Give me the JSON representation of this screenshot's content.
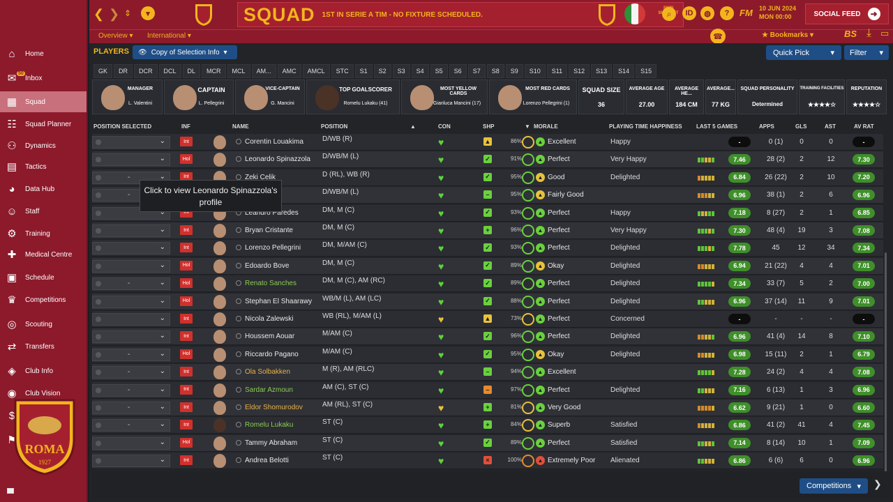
{
  "header": {
    "title": "SQUAD",
    "subtitle": "1ST IN SERIE A TIM - NO FIXTURE SCHEDULED.",
    "skin_support": "SKIN SUPPORT",
    "id_label": "ID",
    "help_label": "?",
    "fm_label": "FM",
    "date": "10 JUN 2024",
    "time": "MON 00:00",
    "social_feed": "SOCIAL FEED"
  },
  "subheader": {
    "overview": "Overview",
    "international": "International",
    "bookmarks": "Bookmarks",
    "bs": "BS"
  },
  "sidebar": {
    "inbox_badge": "50",
    "items": [
      {
        "label": "Home",
        "icon": "home-icon",
        "glyph": "⌂"
      },
      {
        "label": "Inbox",
        "icon": "inbox-icon",
        "glyph": "✉"
      },
      {
        "label": "Squad",
        "icon": "squad-icon",
        "glyph": "▦"
      },
      {
        "label": "Squad Planner",
        "icon": "squad-planner-icon",
        "glyph": "☷"
      },
      {
        "label": "Dynamics",
        "icon": "dynamics-icon",
        "glyph": "⚇"
      },
      {
        "label": "Tactics",
        "icon": "tactics-icon",
        "glyph": "▤"
      },
      {
        "label": "Data Hub",
        "icon": "data-hub-icon",
        "glyph": "◕"
      },
      {
        "label": "Staff",
        "icon": "staff-icon",
        "glyph": "☺"
      },
      {
        "label": "Training",
        "icon": "training-icon",
        "glyph": "⚙"
      },
      {
        "label": "Medical Centre",
        "icon": "medical-centre-icon",
        "glyph": "✚"
      },
      {
        "label": "Schedule",
        "icon": "schedule-icon",
        "glyph": "▣"
      },
      {
        "label": "Competitions",
        "icon": "competitions-icon",
        "glyph": "♛"
      },
      {
        "label": "Scouting",
        "icon": "scouting-icon",
        "glyph": "◎"
      },
      {
        "label": "Transfers",
        "icon": "transfers-icon",
        "glyph": "⇄"
      },
      {
        "label": "Club Info",
        "icon": "club-info-icon",
        "glyph": "◈"
      },
      {
        "label": "Club Vision",
        "icon": "club-vision-icon",
        "glyph": "◉"
      },
      {
        "label": "Finances",
        "icon": "finances-icon",
        "glyph": "$"
      },
      {
        "label": "Dev. Centre",
        "icon": "dev-centre-icon",
        "glyph": "⚑"
      }
    ],
    "crest_year": "1927",
    "crest_text": "ROMA"
  },
  "toolbar": {
    "players_label": "PLAYERS",
    "copy_selection": "Copy of Selection Info",
    "quick_pick": "Quick Pick",
    "filter": "Filter"
  },
  "position_tabs": [
    "GK",
    "DR",
    "DCR",
    "DCL",
    "DL",
    "MCR",
    "MCL",
    "AM...",
    "AMC",
    "AMCL",
    "STC",
    "S1",
    "S2",
    "S3",
    "S4",
    "S5",
    "S6",
    "S7",
    "S8",
    "S9",
    "S10",
    "S11",
    "S12",
    "S13",
    "S14",
    "S15"
  ],
  "cards": {
    "manager": {
      "title": "MANAGER",
      "value": "L. Valentini"
    },
    "captain": {
      "title": "CAPTAIN",
      "value": "L. Pellegrini"
    },
    "vice_captain": {
      "title": "VICE-CAPTAIN",
      "value": "G. Mancini"
    },
    "top_goalscorer": {
      "title": "TOP GOALSCORER",
      "value": "Romelu Lukaku (41)"
    },
    "most_yellow": {
      "title": "MOST YELLOW CARDS",
      "value": "Gianluca Mancini (17)"
    },
    "most_red": {
      "title": "MOST RED CARDS",
      "value": "Lorenzo Pellegrini (1)"
    },
    "squad_size": {
      "title": "SQUAD SIZE",
      "value": "36"
    },
    "average_age": {
      "title": "AVERAGE AGE",
      "value": "27.00"
    },
    "average_height": {
      "title": "AVERAGE HE...",
      "value": "184 CM"
    },
    "average_weight": {
      "title": "AVERAGE...",
      "value": "77 KG"
    },
    "squad_personality": {
      "title": "SQUAD PERSONALITY",
      "value": "Determined"
    },
    "training_facilities": {
      "title": "TRAINING FACILITIES",
      "stars": 4.5
    },
    "reputation": {
      "title": "REPUTATION",
      "stars": 4.5
    }
  },
  "columns": {
    "position_selected": "POSITION SELECTED",
    "inf": "INF",
    "name": "NAME",
    "position": "POSITION",
    "con": "CON",
    "shp": "SHP",
    "morale": "MORALE",
    "playing_time": "PLAYING TIME HAPPINESS",
    "last5": "LAST 5 GAMES",
    "apps": "APPS",
    "gls": "GLS",
    "ast": "AST",
    "avrat": "AV RAT"
  },
  "players": [
    {
      "sel": "",
      "inf": "Int",
      "name": "Corentin Louakima",
      "color": "",
      "pos": "D/WB (R)",
      "con": "♥",
      "conc": "",
      "shp": "▲",
      "shpc": "up",
      "cond": "86%",
      "ring": "y",
      "mic": "",
      "morale": "Excellent",
      "pt": "Happy",
      "form": "",
      "frat": "-",
      "frc": "black",
      "apps": "0 (1)",
      "gls": "0",
      "ast": "0",
      "avr": "-",
      "avc": "black",
      "dark": false
    },
    {
      "sel": "",
      "inf": "Hol",
      "name": "Leonardo Spinazzola",
      "color": "",
      "pos": "D/WB/M (L)",
      "con": "♥",
      "conc": "",
      "shp": "✓",
      "shpc": "",
      "cond": "91%",
      "ring": "",
      "mic": "",
      "morale": "Perfect",
      "pt": "Very Happy",
      "form": "ggyyg",
      "frat": "7.46",
      "frc": "",
      "apps": "28 (2)",
      "gls": "2",
      "ast": "12",
      "avr": "7.30",
      "avc": "",
      "dark": false
    },
    {
      "sel": "-",
      "inf": "Int",
      "name": "Zeki Celik",
      "color": "",
      "pos": "D (RL), WB (R)",
      "con": "♥",
      "conc": "",
      "shp": "✓",
      "shpc": "",
      "cond": "95%",
      "ring": "",
      "mic": "y",
      "morale": "Good",
      "pt": "Delighted",
      "form": "oyyyy",
      "frat": "6.84",
      "frc": "",
      "apps": "26 (22)",
      "gls": "2",
      "ast": "10",
      "avr": "7.20",
      "avc": "",
      "dark": false
    },
    {
      "sel": "-",
      "inf": "Int",
      "name": "",
      "color": "",
      "pos": "D/WB/M (L)",
      "con": "♥",
      "conc": "",
      "shp": "–",
      "shpc": "",
      "cond": "95%",
      "ring": "",
      "mic": "y",
      "morale": "Fairly Good",
      "pt": "",
      "form": "oooyy",
      "frat": "6.96",
      "frc": "",
      "apps": "38 (1)",
      "gls": "2",
      "ast": "6",
      "avr": "6.96",
      "avc": "",
      "dark": false
    },
    {
      "sel": "",
      "inf": "Int",
      "name": "Leandro Paredes",
      "color": "",
      "pos": "DM, M (C)",
      "con": "♥",
      "conc": "",
      "shp": "✓",
      "shpc": "",
      "cond": "93%",
      "ring": "",
      "mic": "",
      "morale": "Perfect",
      "pt": "Happy",
      "form": "gyygg",
      "frat": "7.18",
      "frc": "",
      "apps": "8 (27)",
      "gls": "2",
      "ast": "1",
      "avr": "6.85",
      "avc": "",
      "dark": false
    },
    {
      "sel": "",
      "inf": "Int",
      "name": "Bryan Cristante",
      "color": "",
      "pos": "DM, M (C)",
      "con": "♥",
      "conc": "",
      "shp": "+",
      "shpc": "",
      "cond": "96%",
      "ring": "",
      "mic": "",
      "morale": "Perfect",
      "pt": "Very Happy",
      "form": "gggyg",
      "frat": "7.30",
      "frc": "",
      "apps": "48 (4)",
      "gls": "19",
      "ast": "3",
      "avr": "7.08",
      "avc": "",
      "dark": false
    },
    {
      "sel": "",
      "inf": "Int",
      "name": "Lorenzo Pellegrini",
      "color": "",
      "pos": "DM, M/AM (C)",
      "con": "♥",
      "conc": "",
      "shp": "✓",
      "shpc": "",
      "cond": "93%",
      "ring": "",
      "mic": "",
      "morale": "Perfect",
      "pt": "Delighted",
      "form": "gggyg",
      "frat": "7.78",
      "frc": "",
      "apps": "45",
      "gls": "12",
      "ast": "34",
      "avr": "7.34",
      "avc": "",
      "dark": false
    },
    {
      "sel": "",
      "inf": "Hol",
      "name": "Edoardo Bove",
      "color": "",
      "pos": "DM, M (C)",
      "con": "♥",
      "conc": "",
      "shp": "✓",
      "shpc": "",
      "cond": "89%",
      "ring": "",
      "mic": "y",
      "morale": "Okay",
      "pt": "Delighted",
      "form": "ooyyy",
      "frat": "6.94",
      "frc": "",
      "apps": "21 (22)",
      "gls": "4",
      "ast": "4",
      "avr": "7.01",
      "avc": "",
      "dark": false
    },
    {
      "sel": "-",
      "inf": "Hol",
      "name": "Renato Sanches",
      "color": "green",
      "pos": "DM, M (C), AM (RC)",
      "con": "♥",
      "conc": "",
      "shp": "✓",
      "shpc": "",
      "cond": "89%",
      "ring": "",
      "mic": "",
      "morale": "Perfect",
      "pt": "Delighted",
      "form": "ggggy",
      "frat": "7.34",
      "frc": "",
      "apps": "33 (7)",
      "gls": "5",
      "ast": "2",
      "avr": "7.00",
      "avc": "",
      "dark": false
    },
    {
      "sel": "",
      "inf": "Hol",
      "name": "Stephan El Shaarawy",
      "color": "",
      "pos": "WB/M (L), AM (LC)",
      "con": "♥",
      "conc": "",
      "shp": "✓",
      "shpc": "",
      "cond": "88%",
      "ring": "",
      "mic": "",
      "morale": "Perfect",
      "pt": "Delighted",
      "form": "ggyyy",
      "frat": "6.96",
      "frc": "",
      "apps": "37 (14)",
      "gls": "11",
      "ast": "9",
      "avr": "7.01",
      "avc": "",
      "dark": false
    },
    {
      "sel": "",
      "inf": "Int",
      "name": "Nicola Zalewski",
      "color": "",
      "pos": "WB (RL), M/AM (L)",
      "con": "♥",
      "conc": "yellow",
      "shp": "▲",
      "shpc": "up",
      "cond": "73%",
      "ring": "y",
      "mic": "",
      "morale": "Perfect",
      "pt": "Concerned",
      "form": "",
      "frat": "-",
      "frc": "black",
      "apps": "-",
      "gls": "-",
      "ast": "-",
      "avr": "-",
      "avc": "black",
      "dark": false
    },
    {
      "sel": "",
      "inf": "Int",
      "name": "Houssem Aouar",
      "color": "",
      "pos": "M/AM (C)",
      "con": "♥",
      "conc": "",
      "shp": "✓",
      "shpc": "",
      "cond": "96%",
      "ring": "",
      "mic": "",
      "morale": "Perfect",
      "pt": "Delighted",
      "form": "ooyyg",
      "frat": "6.96",
      "frc": "",
      "apps": "41 (4)",
      "gls": "14",
      "ast": "8",
      "avr": "7.10",
      "avc": "",
      "dark": false
    },
    {
      "sel": "-",
      "inf": "Hol",
      "name": "Riccardo Pagano",
      "color": "",
      "pos": "M/AM (C)",
      "con": "♥",
      "conc": "",
      "shp": "✓",
      "shpc": "",
      "cond": "95%",
      "ring": "",
      "mic": "y",
      "morale": "Okay",
      "pt": "Delighted",
      "form": "ooyyy",
      "frat": "6.98",
      "frc": "",
      "apps": "15 (11)",
      "gls": "2",
      "ast": "1",
      "avr": "6.79",
      "avc": "",
      "dark": false
    },
    {
      "sel": "-",
      "inf": "Int",
      "name": "Ola Solbakken",
      "color": "yellow",
      "pos": "M (R), AM (RLC)",
      "con": "♥",
      "conc": "",
      "shp": "–",
      "shpc": "",
      "cond": "94%",
      "ring": "",
      "mic": "",
      "morale": "Excellent",
      "pt": "",
      "form": "ggggy",
      "frat": "7.28",
      "frc": "",
      "apps": "24 (2)",
      "gls": "4",
      "ast": "4",
      "avr": "7.08",
      "avc": "",
      "dark": false
    },
    {
      "sel": "-",
      "inf": "Int",
      "name": "Sardar Azmoun",
      "color": "green",
      "pos": "AM (C), ST (C)",
      "con": "♥",
      "conc": "",
      "shp": "–",
      "shpc": "orange",
      "cond": "97%",
      "ring": "",
      "mic": "",
      "morale": "Perfect",
      "pt": "Delighted",
      "form": "ggyyy",
      "frat": "7.16",
      "frc": "",
      "apps": "6 (13)",
      "gls": "1",
      "ast": "3",
      "avr": "6.96",
      "avc": "",
      "dark": false
    },
    {
      "sel": "-",
      "inf": "Int",
      "name": "Eldor Shomurodov",
      "color": "yellow",
      "pos": "AM (RL), ST (C)",
      "con": "♥",
      "conc": "yellow",
      "shp": "+",
      "shpc": "",
      "cond": "81%",
      "ring": "y",
      "mic": "",
      "morale": "Very Good",
      "pt": "",
      "form": "ooooy",
      "frat": "6.62",
      "frc": "",
      "apps": "9 (21)",
      "gls": "1",
      "ast": "0",
      "avr": "6.60",
      "avc": "",
      "dark": false
    },
    {
      "sel": "-",
      "inf": "Int",
      "name": "Romelu Lukaku",
      "color": "green",
      "pos": "ST (C)",
      "con": "♥",
      "conc": "",
      "shp": "+",
      "shpc": "",
      "cond": "84%",
      "ring": "y",
      "mic": "",
      "morale": "Superb",
      "pt": "Satisfied",
      "form": "oyyyy",
      "frat": "6.86",
      "frc": "",
      "apps": "41 (2)",
      "gls": "41",
      "ast": "4",
      "avr": "7.45",
      "avc": "",
      "dark": true
    },
    {
      "sel": "",
      "inf": "Hol",
      "name": "Tammy Abraham",
      "color": "",
      "pos": "ST (C)",
      "con": "♥",
      "conc": "",
      "shp": "✓",
      "shpc": "",
      "cond": "89%",
      "ring": "",
      "mic": "",
      "morale": "Perfect",
      "pt": "Satisfied",
      "form": "ggyyg",
      "frat": "7.14",
      "frc": "",
      "apps": "8 (14)",
      "gls": "10",
      "ast": "1",
      "avr": "7.09",
      "avc": "",
      "dark": false
    },
    {
      "sel": "",
      "inf": "Int",
      "name": "Andrea Belotti",
      "color": "",
      "pos": "ST (C)",
      "con": "♥",
      "conc": "",
      "shp": "×",
      "shpc": "red",
      "cond": "100%",
      "ring": "o",
      "mic": "r",
      "morale": "Extremely Poor",
      "pt": "Alienated",
      "form": "ggyyy",
      "frat": "6.86",
      "frc": "",
      "apps": "6 (6)",
      "gls": "6",
      "ast": "0",
      "avr": "6.96",
      "avc": "",
      "dark": false
    }
  ],
  "tooltip": "Click to view Leonardo Spinazzola's profile",
  "footer": {
    "competitions": "Competitions"
  }
}
